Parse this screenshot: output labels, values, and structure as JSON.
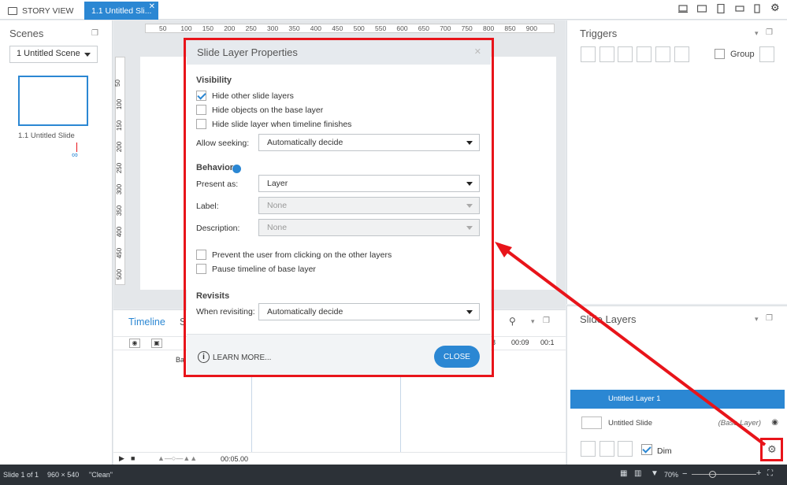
{
  "tabs": {
    "story": "STORY VIEW",
    "slide": "1.1 Untitled Sli..."
  },
  "scenes": {
    "title": "Scenes",
    "selected_scene": "1 Untitled Scene",
    "slide_label": "1.1 Untitled Slide"
  },
  "ruler": {
    "top_ticks": [
      "50",
      "100",
      "150",
      "200",
      "250",
      "300",
      "350",
      "400",
      "450",
      "500",
      "550",
      "600",
      "650",
      "700",
      "750",
      "800",
      "850",
      "900"
    ],
    "left_ticks": [
      "50",
      "100",
      "150",
      "200",
      "250",
      "300",
      "350",
      "400",
      "450",
      "500"
    ]
  },
  "timeline": {
    "title": "Timeline",
    "t1": "8",
    "t2": "00:09",
    "t3": "00:1",
    "duration": "00:05.00",
    "row": "Ba"
  },
  "triggers": {
    "title": "Triggers",
    "group": "Group"
  },
  "layers": {
    "title": "Slide Layers",
    "layer1": "Untitled Layer 1",
    "base": "Untitled Slide",
    "base_tag": "(Base Layer)",
    "dim": "Dim"
  },
  "status": {
    "slide": "Slide 1 of 1",
    "size": "960 × 540",
    "state": "\"Clean\"",
    "zoom": "70%"
  },
  "modal": {
    "title": "Slide Layer Properties",
    "visibility": "Visibility",
    "hide_other": "Hide other slide layers",
    "hide_base": "Hide objects on the base layer",
    "hide_finish": "Hide slide layer when timeline finishes",
    "seeking_label": "Allow seeking:",
    "seeking_value": "Automatically decide",
    "behavior": "Behavior",
    "present_label": "Present as:",
    "present_value": "Layer",
    "label_label": "Label:",
    "label_value": "None",
    "desc_label": "Description:",
    "desc_value": "None",
    "prevent": "Prevent the user from clicking on the other layers",
    "pause": "Pause timeline of base layer",
    "revisits": "Revisits",
    "revisit_label": "When revisiting:",
    "revisit_value": "Automatically decide",
    "learn_more": "LEARN MORE...",
    "close": "CLOSE"
  },
  "colors": {
    "accent": "#2b87d3",
    "highlight": "#e8141a",
    "statusbar": "#2c3137"
  }
}
